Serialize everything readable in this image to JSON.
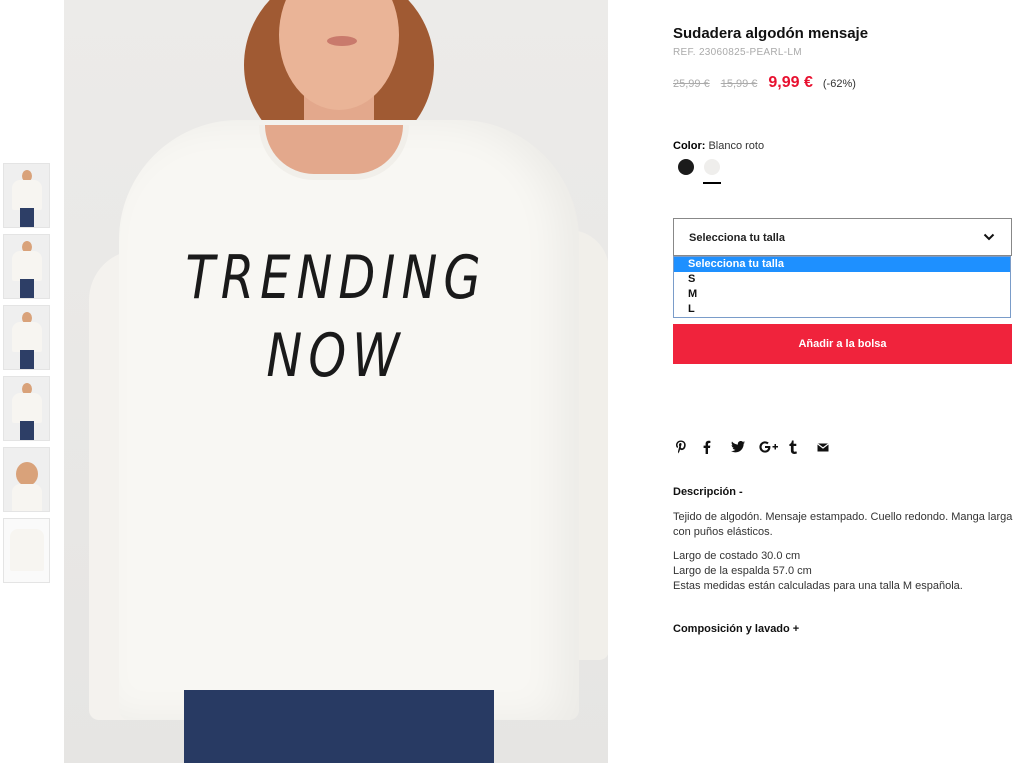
{
  "product": {
    "title": "Sudadera algodón mensaje",
    "ref": "REF. 23060825-PEARL-LM",
    "price_original": "25,99 €",
    "price_previous": "15,99 €",
    "price_current": "9,99 €",
    "discount": "(-62%)"
  },
  "image": {
    "slogan_line1": "TRENDING",
    "slogan_line2": "NOW"
  },
  "color": {
    "label": "Color:",
    "value": "Blanco roto",
    "swatches": [
      "#1b1b1b",
      "#efeeec"
    ],
    "selected_index": 1
  },
  "size": {
    "placeholder": "Selecciona tu talla",
    "options": [
      "Selecciona tu talla",
      "S",
      "M",
      "L"
    ],
    "highlighted_index": 0
  },
  "actions": {
    "add_to_bag": "Añadir a la bolsa"
  },
  "share": [
    "pinterest-icon",
    "facebook-icon",
    "twitter-icon",
    "google-plus-icon",
    "tumblr-icon",
    "email-icon"
  ],
  "description": {
    "heading": "Descripción -",
    "paragraph1": "Tejido de algodón. Mensaje estampado. Cuello redondo. Manga larga con puños elásticos.",
    "measure1": "Largo de costado 30.0 cm",
    "measure2": "Largo de la espalda 57.0 cm",
    "measure3": "Estas medidas están calculadas para una talla M española."
  },
  "composition": {
    "heading": "Composición y lavado +"
  },
  "colors": {
    "accent": "#e8102f",
    "button": "#f0233c",
    "dropdown_highlight": "#1e90ff"
  }
}
